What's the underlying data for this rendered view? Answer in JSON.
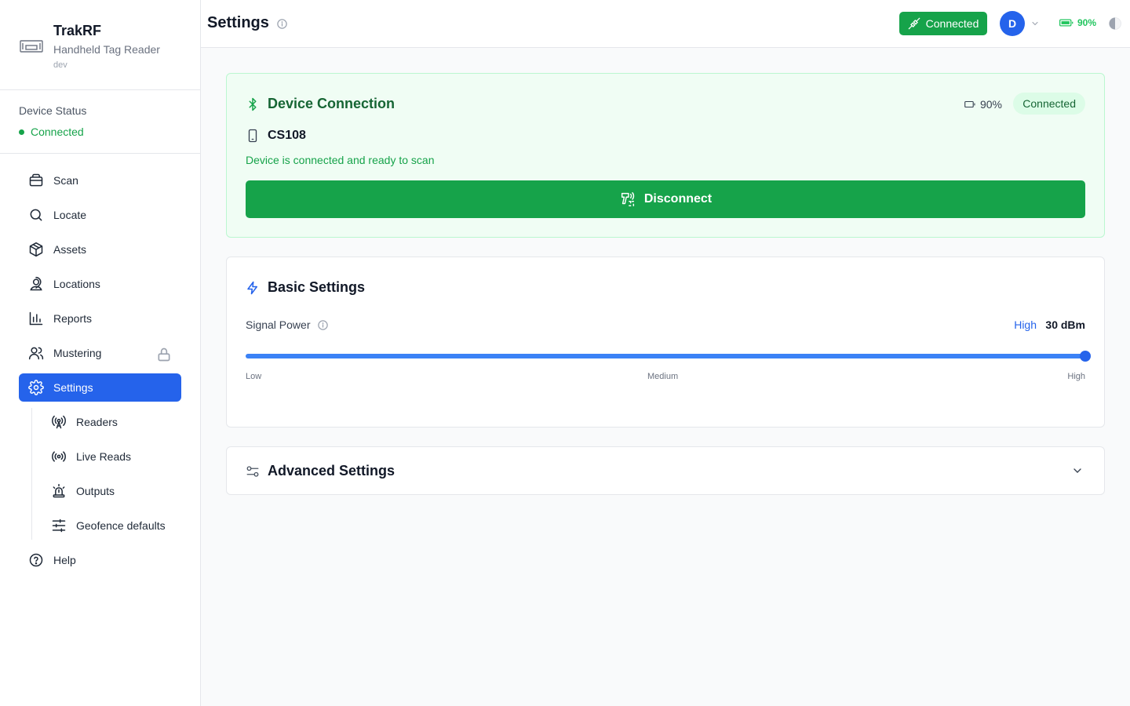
{
  "brand": {
    "name": "TrakRF",
    "subtitle": "Handheld Tag Reader",
    "env": "dev"
  },
  "device_status": {
    "label": "Device Status",
    "value": "Connected"
  },
  "nav": {
    "scan": "Scan",
    "locate": "Locate",
    "assets": "Assets",
    "locations": "Locations",
    "reports": "Reports",
    "mustering": "Mustering",
    "settings": "Settings",
    "readers": "Readers",
    "live_reads": "Live Reads",
    "outputs": "Outputs",
    "geofence_defaults": "Geofence defaults",
    "help": "Help"
  },
  "header": {
    "title": "Settings",
    "connection_label": "Connected",
    "avatar_initial": "D",
    "battery": "90%"
  },
  "device_card": {
    "title": "Device Connection",
    "battery": "90%",
    "status_badge": "Connected",
    "device_name": "CS108",
    "message": "Device is connected and ready to scan",
    "disconnect_label": "Disconnect"
  },
  "basic_settings": {
    "title": "Basic Settings",
    "signal_power_label": "Signal Power",
    "level_label": "High",
    "value_label": "30 dBm",
    "slider_fraction": 1.0,
    "ticks": {
      "low": "Low",
      "medium": "Medium",
      "high": "High"
    }
  },
  "advanced_settings": {
    "title": "Advanced Settings"
  },
  "colors": {
    "primary": "#2563eb",
    "success": "#16a34a",
    "success_bg": "#f0fdf4"
  }
}
